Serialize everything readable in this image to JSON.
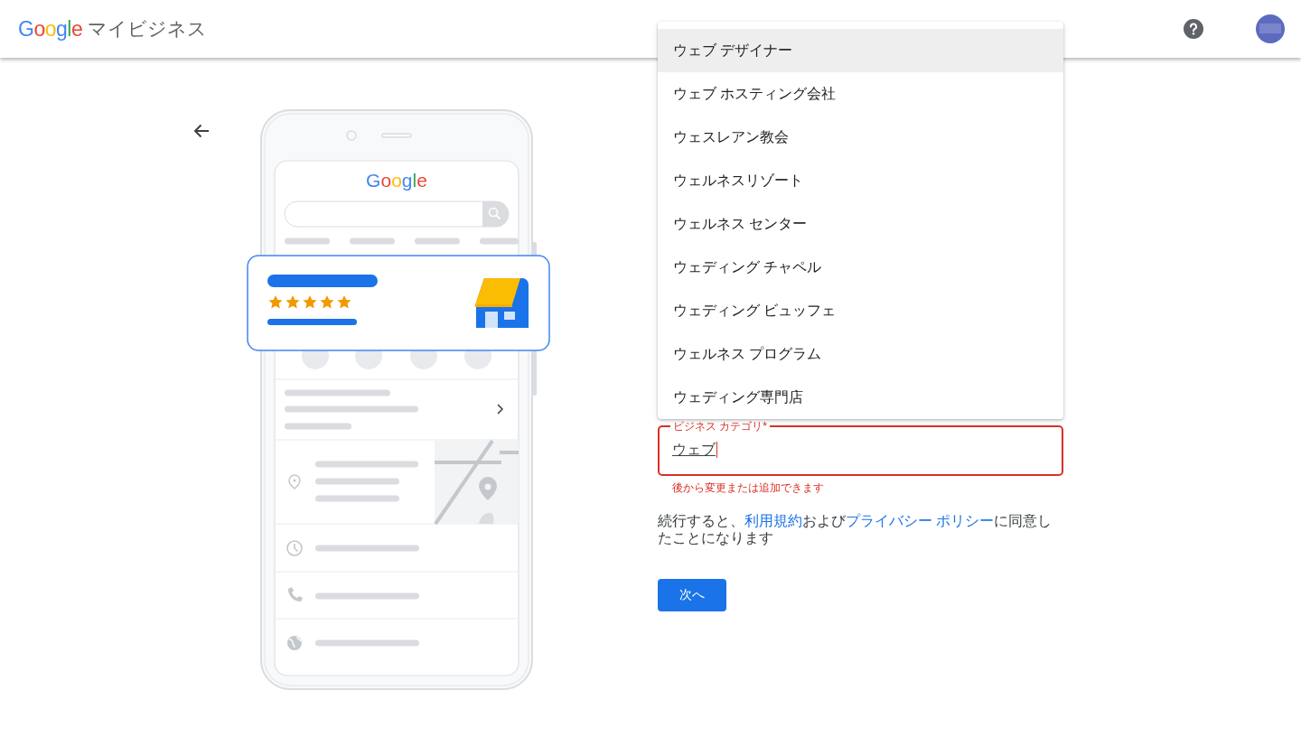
{
  "header": {
    "logo": "Google",
    "product": "マイビジネス"
  },
  "illustration": {
    "logo": "Google"
  },
  "category_dropdown": {
    "options": [
      {
        "label": "ウェブ デザイナー",
        "selected": true
      },
      {
        "label": "ウェブ ホスティング会社",
        "selected": false
      },
      {
        "label": "ウェスレアン教会",
        "selected": false
      },
      {
        "label": "ウェルネスリゾート",
        "selected": false
      },
      {
        "label": "ウェルネス センター",
        "selected": false
      },
      {
        "label": "ウェディング チャペル",
        "selected": false
      },
      {
        "label": "ウェディング ビュッフェ",
        "selected": false
      },
      {
        "label": "ウェルネス プログラム",
        "selected": false
      },
      {
        "label": "ウェディング専門店",
        "selected": false
      }
    ]
  },
  "category_field": {
    "label": "ビジネス カテゴリ*",
    "value": "ウェブ",
    "helper": "後から変更または追加できます",
    "error": true
  },
  "consent": [
    {
      "kind": "text",
      "text": "続行すると、"
    },
    {
      "kind": "link",
      "text": "利用規約"
    },
    {
      "kind": "text",
      "text": "および"
    },
    {
      "kind": "link",
      "text": "プライバシー ポリシー"
    },
    {
      "kind": "text",
      "text": "に同意したことになります"
    }
  ],
  "next_button": "次へ"
}
